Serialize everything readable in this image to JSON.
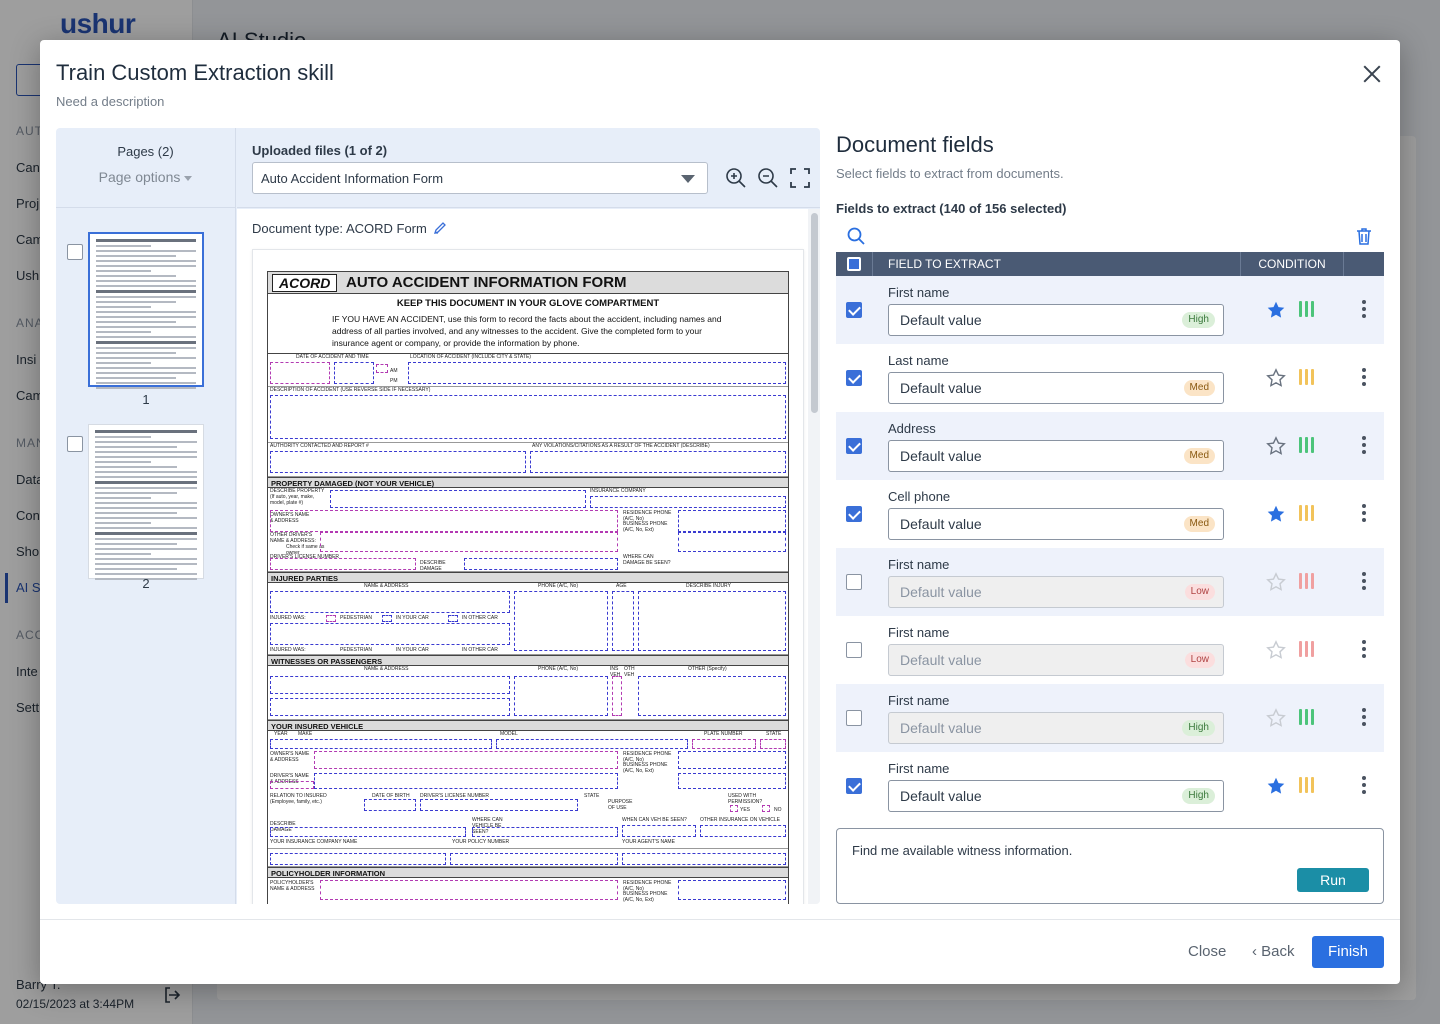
{
  "background": {
    "logo": "ushur",
    "page_title": "AI Studio",
    "nav": [
      {
        "label": "AUT",
        "section": true
      },
      {
        "label": "Can"
      },
      {
        "label": "Proj"
      },
      {
        "label": "Cam"
      },
      {
        "label": "Ush"
      },
      {
        "label": "ANA",
        "section": true
      },
      {
        "label": "Insi"
      },
      {
        "label": "Cam"
      },
      {
        "label": "MAN",
        "section": true
      },
      {
        "label": "Data"
      },
      {
        "label": "Con"
      },
      {
        "label": "Sho"
      },
      {
        "label": "AI S",
        "active": true
      },
      {
        "label": "ACC",
        "section": true
      },
      {
        "label": "Inte"
      },
      {
        "label": "Sett"
      }
    ],
    "user_name": "Barry T.",
    "user_date": "02/15/2023 at 3:44PM",
    "logout_icon": "logout-icon"
  },
  "modal": {
    "title": "Train Custom Extraction skill",
    "subtitle": "Need a description",
    "close_icon": "close-icon",
    "pages": {
      "title": "Pages (2)",
      "options_label": "Page options",
      "items": [
        {
          "number": "1",
          "selected": true
        },
        {
          "number": "2",
          "selected": false
        }
      ]
    },
    "viewer": {
      "uploaded_label": "Uploaded files (1 of 2)",
      "selected_file": "Auto Accident Information Form",
      "document_type": "Document type: ACORD Form",
      "tools": [
        "zoom-in-icon",
        "zoom-out-icon",
        "fullscreen-icon"
      ]
    },
    "document": {
      "logo": "ACORD",
      "title": "AUTO ACCIDENT INFORMATION FORM",
      "keep": "KEEP THIS DOCUMENT IN YOUR GLOVE COMPARTMENT",
      "note": "IF YOU HAVE AN ACCIDENT, use this form to record the facts about the accident, including names and address of all parties involved, and any witnesses to the accident. Give the completed form to your insurance agent or company, or provide the information by phone.",
      "labels": {
        "date": "DATE OF ACCIDENT AND TIME",
        "location": "LOCATION OF ACCIDENT (INCLUDE CITY & STATE)",
        "am": "AM",
        "pm": "PM",
        "description": "DESCRIPTION OF ACCIDENT (USE REVERSE SIDE IF NECESSARY)",
        "authority": "AUTHORITY CONTACTED AND REPORT #",
        "violations": "ANY VIOLATIONS/CITATIONS AS A RESULT OF THE ACCIDENT (DESCRIBE)",
        "describe_property": "DESCRIBE PROPERTY (If auto, year, make, model, plate #)",
        "insurance_company": "INSURANCE COMPANY",
        "owner": "OWNER'S NAME & ADDRESS",
        "other_driver": "OTHER DRIVER'S NAME & ADDRESS:",
        "check_if": "Check if same as owner",
        "residence_phone": "RESIDENCE PHONE (A/C, No)",
        "business_phone": "BUSINESS PHONE (A/C, No, Ext)",
        "drivers_license": "DRIVER'S LICENSE NUMBER",
        "describe_damage": "DESCRIBE DAMAGE",
        "where_can_damage": "WHERE CAN DAMAGE BE SEEN?",
        "name_address": "NAME & ADDRESS",
        "phone": "PHONE (A/C, No)",
        "age": "AGE",
        "describe_injury": "DESCRIBE INJURY",
        "injured_was": "INJURED WAS:",
        "pedestrian": "PEDESTRIAN",
        "in_your_car": "IN YOUR CAR",
        "in_other_car": "IN OTHER CAR",
        "ins_veh": "INS VEH",
        "oth_veh": "OTH VEH",
        "other_specify": "OTHER (Specify)",
        "year": "YEAR",
        "make": "MAKE",
        "model": "MODEL",
        "plate": "PLATE NUMBER",
        "state": "STATE",
        "drivers_name": "DRIVER'S NAME & ADDRESS",
        "relation": "RELATION TO INSURED (Employee, family, etc.)",
        "dob": "DATE OF BIRTH",
        "license_no": "DRIVER'S LICENSE NUMBER",
        "purpose": "PURPOSE OF USE",
        "used_with": "USED WITH PERMISSION?",
        "yes": "YES",
        "no": "NO",
        "where_veh": "WHERE CAN VEHICLE BE SEEN?",
        "when_veh": "WHEN CAN VEH BE SEEN?",
        "other_ins": "OTHER INSURANCE ON VEHICLE",
        "your_ins_co": "YOUR INSURANCE COMPANY NAME",
        "your_policy": "YOUR POLICY NUMBER",
        "your_agent": "YOUR AGENT'S NAME",
        "policyholder_name": "POLICYHOLDER'S NAME & ADDRESS"
      },
      "sections": {
        "property": "PROPERTY DAMAGED (NOT YOUR VEHICLE)",
        "injured": "INJURED PARTIES",
        "witnesses": "WITNESSES OR PASSENGERS",
        "vehicle": "YOUR INSURED VEHICLE",
        "policyholder": "POLICYHOLDER INFORMATION"
      }
    },
    "fields": {
      "title": "Document fields",
      "subtitle": "Select fields to extract from documents.",
      "count_label": "Fields to extract (140 of 156 selected)",
      "search_icon": "search-icon",
      "trash_icon": "trash-icon",
      "col_field": "FIELD TO EXTRACT",
      "col_condition": "CONDITION",
      "placeholder": "Default value",
      "rows": [
        {
          "name": "First name",
          "checked": true,
          "badge": "High",
          "level": "high",
          "starred": true,
          "bars": "#4cc47a"
        },
        {
          "name": "Last name",
          "checked": true,
          "badge": "Med",
          "level": "med",
          "starred": false,
          "bars": "#f2c35a"
        },
        {
          "name": "Address",
          "checked": true,
          "badge": "Med",
          "level": "med",
          "starred": false,
          "bars": "#4cc47a"
        },
        {
          "name": "Cell phone",
          "checked": true,
          "badge": "Med",
          "level": "med",
          "starred": true,
          "bars": "#f2c35a"
        },
        {
          "name": "First name",
          "checked": false,
          "badge": "Low",
          "level": "low",
          "starred": false,
          "bars": "#f0a0a0"
        },
        {
          "name": "First name",
          "checked": false,
          "badge": "Low",
          "level": "low",
          "starred": false,
          "bars": "#f0a0a0"
        },
        {
          "name": "First name",
          "checked": false,
          "badge": "High",
          "level": "high",
          "starred": false,
          "bars": "#4cc47a"
        },
        {
          "name": "First name",
          "checked": true,
          "badge": "High",
          "level": "high",
          "starred": true,
          "bars": "#f2c35a"
        }
      ],
      "prompt_text": "Find me available witness information.",
      "run_label": "Run"
    },
    "footer": {
      "close_label": "Close",
      "back_label": "Back",
      "finish_label": "Finish"
    },
    "colors": {
      "accent": "#2a6fe0",
      "run": "#1b8ea6",
      "header": "#4a5a74",
      "star_active": "#2a6fe0",
      "star_inactive": "#6a7380"
    }
  }
}
